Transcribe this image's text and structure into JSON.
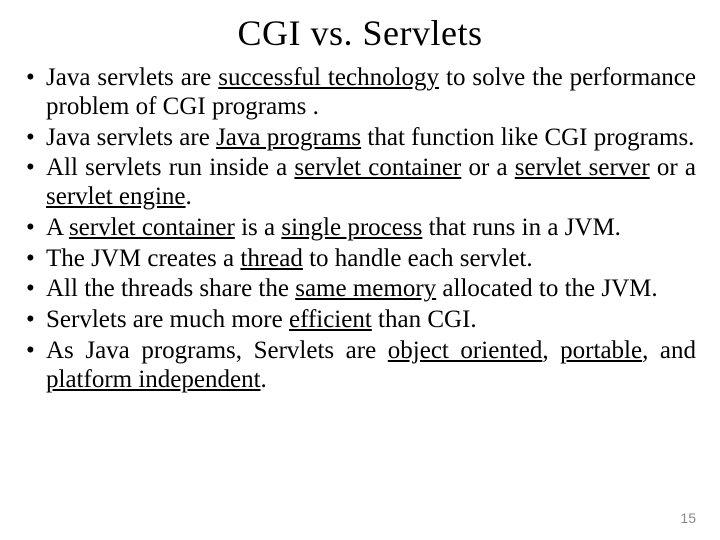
{
  "title": "CGI vs. Servlets",
  "bullets": [
    {
      "pre": "Java servlets are ",
      "u1": "successful technology",
      "mid1": " to solve the performance problem of CGI programs .",
      "u2": "",
      "mid2": "",
      "u3": "",
      "post": ""
    },
    {
      "pre": "Java servlets are ",
      "u1": "Java programs",
      "mid1": " that function like CGI programs.",
      "u2": "",
      "mid2": "",
      "u3": "",
      "post": ""
    },
    {
      "pre": "All servlets run inside a ",
      "u1": "servlet container",
      "mid1": " or a ",
      "u2": "servlet server",
      "mid2": " or a ",
      "u3": "servlet engine",
      "post": "."
    },
    {
      "pre": "A ",
      "u1": "servlet container",
      "mid1": " is a ",
      "u2": "single process",
      "mid2": " that runs in a JVM.",
      "u3": "",
      "post": ""
    },
    {
      "pre": "The JVM creates a ",
      "u1": "thread",
      "mid1": " to handle each servlet.",
      "u2": "",
      "mid2": "",
      "u3": "",
      "post": ""
    },
    {
      "pre": "All the threads share the ",
      "u1": "same memory",
      "mid1": " allocated to the JVM.",
      "u2": "",
      "mid2": "",
      "u3": "",
      "post": ""
    },
    {
      "pre": "Servlets are much more ",
      "u1": "efficient",
      "mid1": " than CGI.",
      "u2": "",
      "mid2": "",
      "u3": "",
      "post": ""
    },
    {
      "pre": "As Java programs, Servlets are ",
      "u1": "object oriented",
      "mid1": ", ",
      "u2": "portable",
      "mid2": ", and ",
      "u3": "platform independent",
      "post": "."
    }
  ],
  "page_number": "15"
}
